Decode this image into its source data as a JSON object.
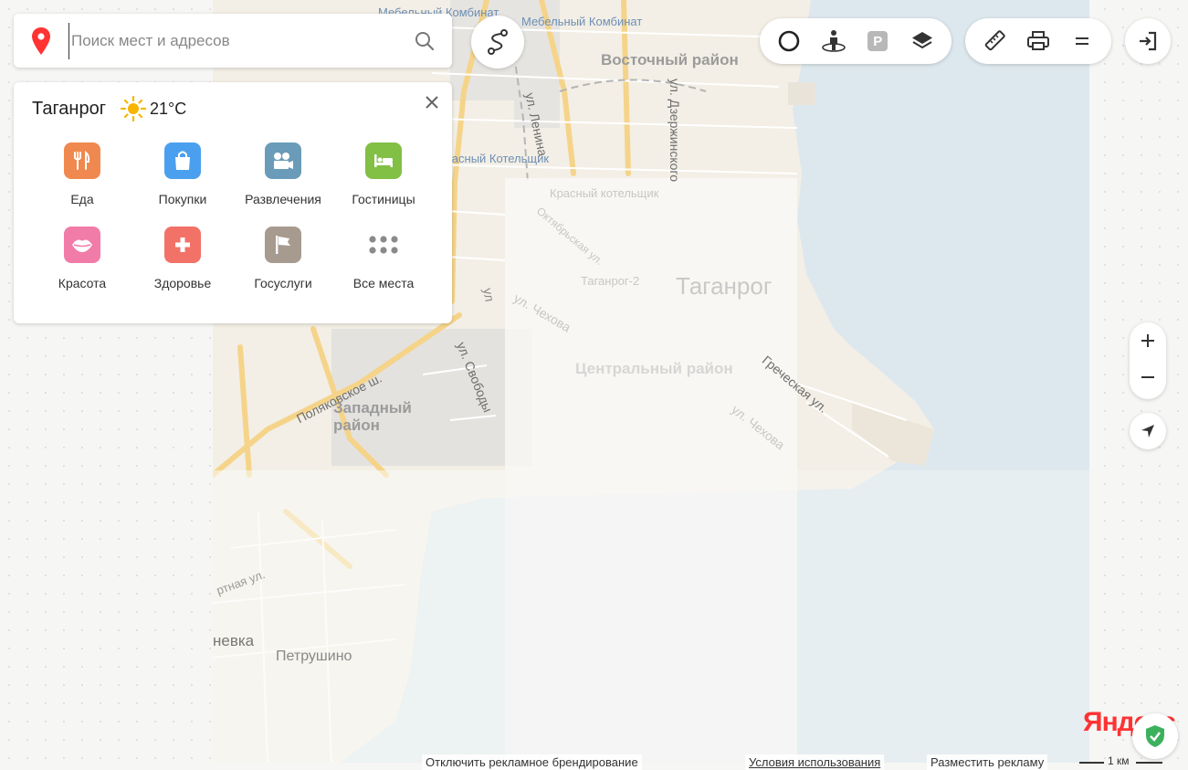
{
  "search": {
    "placeholder": "Поиск мест и адресов",
    "value": ""
  },
  "panel": {
    "city": "Таганрог",
    "temperature": "21°C",
    "weather_icon": "sun-icon",
    "categories": [
      {
        "label": "Еда",
        "icon": "fork-knife-icon",
        "color": "#f0894f"
      },
      {
        "label": "Покупки",
        "icon": "shopping-bag-icon",
        "color": "#4aa0ee"
      },
      {
        "label": "Развлечения",
        "icon": "movie-camera-icon",
        "color": "#6a9bb8"
      },
      {
        "label": "Гостиницы",
        "icon": "bed-icon",
        "color": "#82bf45"
      },
      {
        "label": "Красота",
        "icon": "lips-icon",
        "color": "#f27ca8"
      },
      {
        "label": "Здоровье",
        "icon": "medical-cross-icon",
        "color": "#f27268"
      },
      {
        "label": "Госуслуги",
        "icon": "flag-icon",
        "color": "#a79a8f"
      },
      {
        "label": "Все места",
        "icon": "grid-dots-icon",
        "color": "#8a8a8a"
      }
    ]
  },
  "toolbar": {
    "route_icon": "route-icon",
    "traffic_icon": "traffic-circle-icon",
    "panorama_icon": "panorama-person-icon",
    "parking_label": "P",
    "layers_icon": "layers-icon",
    "ruler_icon": "ruler-icon",
    "print_icon": "printer-icon",
    "menu_icon": "menu-icon",
    "login_icon": "login-icon"
  },
  "map_labels": {
    "mebel_1": "Мебельный Комбинат",
    "mebel_2": "Мебельный Комбинат",
    "vostochny": "Восточный район",
    "lenina": "ул. Ленина",
    "dzerzhinskogo": "ул. Дзержинского",
    "krasny_kotelshchik_1": "Красный Котельщик",
    "krasny_kotelshchik_2": "Красный котельщик",
    "taganrog_station": "Таганрог-2",
    "city": "Таганрог",
    "chekhova_1": "ул. Чехова",
    "chekhova_2": "ул. Чехова",
    "tsentralny": "Центральный район",
    "polyakovskoe": "Поляковское ш.",
    "zapadny": "Западный район",
    "svobody": "ул. Свободы",
    "grecheskaya": "Греческая ул.",
    "nevka": "невка",
    "petrushino": "Петрушино",
    "ul_left": "ртная ул.",
    "ul_short": "ул",
    "oktyabrskaya": "Октябрьская ул."
  },
  "footer": {
    "ad_branding": "Отключить рекламное брендирование",
    "terms": "Условия использования",
    "advertise": "Разместить рекламу",
    "scale": "1 км",
    "logo": "Яндекс"
  },
  "colors": {
    "accent_red": "#f33",
    "water": "#dfe9ef",
    "land": "#f3efe6",
    "road": "#f8d98a"
  }
}
